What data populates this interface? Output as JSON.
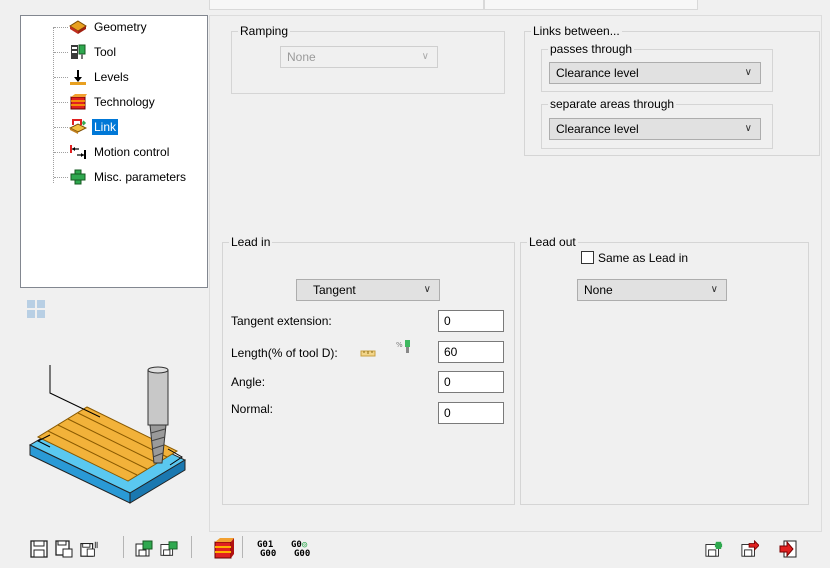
{
  "tree": {
    "items": [
      {
        "label": "Geometry",
        "icon": "geometry-icon"
      },
      {
        "label": "Tool",
        "icon": "tool-icon"
      },
      {
        "label": "Levels",
        "icon": "levels-icon"
      },
      {
        "label": "Technology",
        "icon": "technology-icon"
      },
      {
        "label": "Link",
        "icon": "link-icon",
        "selected": true
      },
      {
        "label": "Motion control",
        "icon": "motion-control-icon"
      },
      {
        "label": "Misc. parameters",
        "icon": "misc-parameters-icon"
      }
    ]
  },
  "ramping": {
    "legend": "Ramping",
    "value": "None"
  },
  "links_between": {
    "legend": "Links between...",
    "passes_legend": "passes through",
    "passes_value": "Clearance level",
    "areas_legend": "separate areas through",
    "areas_value": "Clearance level"
  },
  "lead_in": {
    "legend": "Lead in",
    "type_value": "Tangent",
    "tangent_extension_label": "Tangent extension:",
    "tangent_extension_value": "0",
    "length_label": "Length(% of tool D):",
    "length_value": "60",
    "angle_label": "Angle:",
    "angle_value": "0",
    "normal_label": "Normal:",
    "normal_value": "0"
  },
  "lead_out": {
    "legend": "Lead out",
    "same_as_label": "Same as Lead in",
    "same_as_checked": false,
    "type_value": "None"
  },
  "toolbar": {
    "g01_label": "G01",
    "g00_label": "G00",
    "g0_label": "G0",
    "g00b_label": "G00"
  },
  "colors": {
    "selection": "#0078d7",
    "accent_red": "#e02020",
    "accent_green": "#2fa84f"
  }
}
